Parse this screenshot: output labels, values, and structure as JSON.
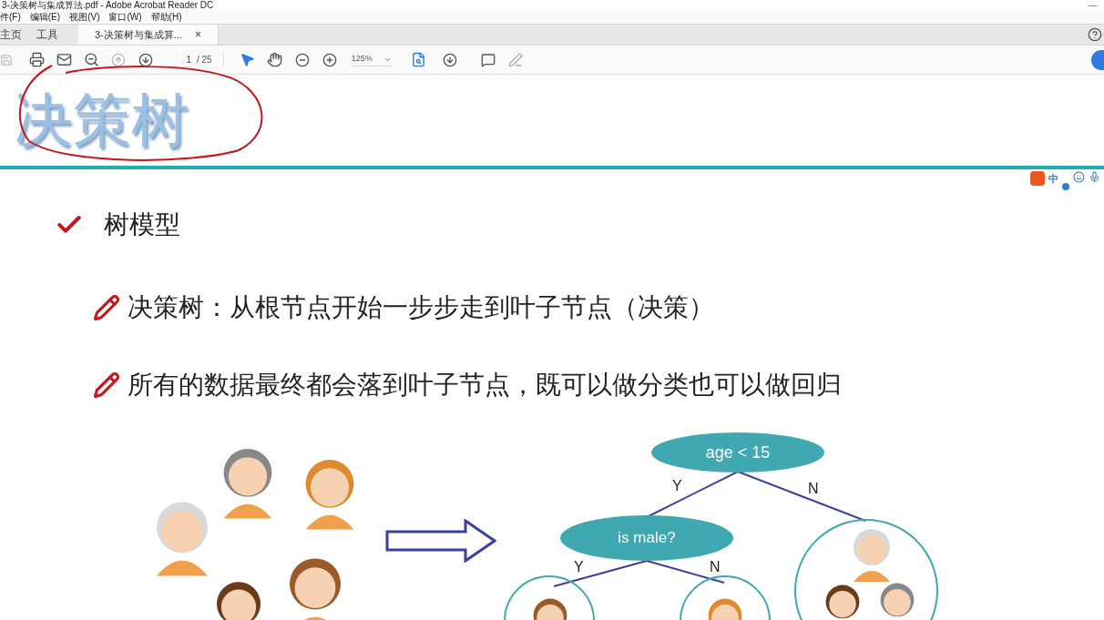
{
  "window": {
    "title": "3-决策树与集成算法.pdf - Adobe Acrobat Reader DC",
    "minimize": "—"
  },
  "menu": [
    "件(F)",
    "编辑(E)",
    "视图(V)",
    "窗口(W)",
    "帮助(H)"
  ],
  "tabs": [
    {
      "label": "主页",
      "selected": false
    },
    {
      "label": "工具",
      "selected": false
    },
    {
      "label": "3-决策树与集成算...",
      "selected": true,
      "close": "×"
    }
  ],
  "toolbar": {
    "page": "1",
    "page_total": "/ 25",
    "zoom": "125%"
  },
  "ime": {
    "label": "中"
  },
  "slide": {
    "title": "决策树",
    "heading": "树模型",
    "bullets": [
      "决策树：从根节点开始一步步走到叶子节点（决策）",
      "所有的数据最终都会落到叶子节点，既可以做分类也可以做回归"
    ],
    "tree": {
      "root": "age < 15",
      "child": "is male?",
      "edges": [
        "Y",
        "N",
        "Y",
        "N"
      ]
    }
  }
}
